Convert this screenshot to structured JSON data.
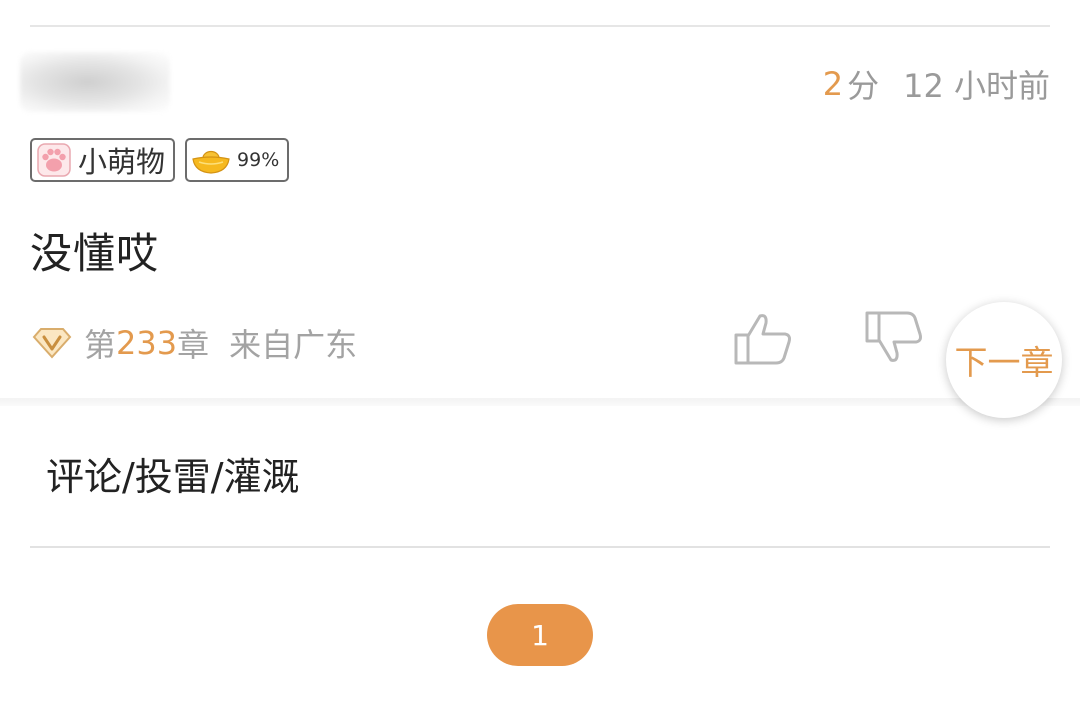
{
  "comment": {
    "score_value": "2",
    "score_unit": "分",
    "time_ago": "12 小时前",
    "badges": {
      "title_text": "小萌物",
      "title_icon": "paw-icon",
      "percent_text": "99%",
      "percent_icon": "gold-ingot-icon"
    },
    "body": "没懂哎",
    "chapter_prefix": "第",
    "chapter_number": "233",
    "chapter_suffix": "章",
    "location": "来自广东",
    "like_icon": "thumbs-up-icon",
    "dislike_icon": "thumbs-down-icon"
  },
  "next_chapter_label": "下一章",
  "comment_entry_label": "评论/投雷/灌溉",
  "pagination": {
    "current_page": "1"
  },
  "colors": {
    "accent": "#e39a4e",
    "page_button": "#e8954a",
    "muted_text": "#a3a3a3"
  }
}
